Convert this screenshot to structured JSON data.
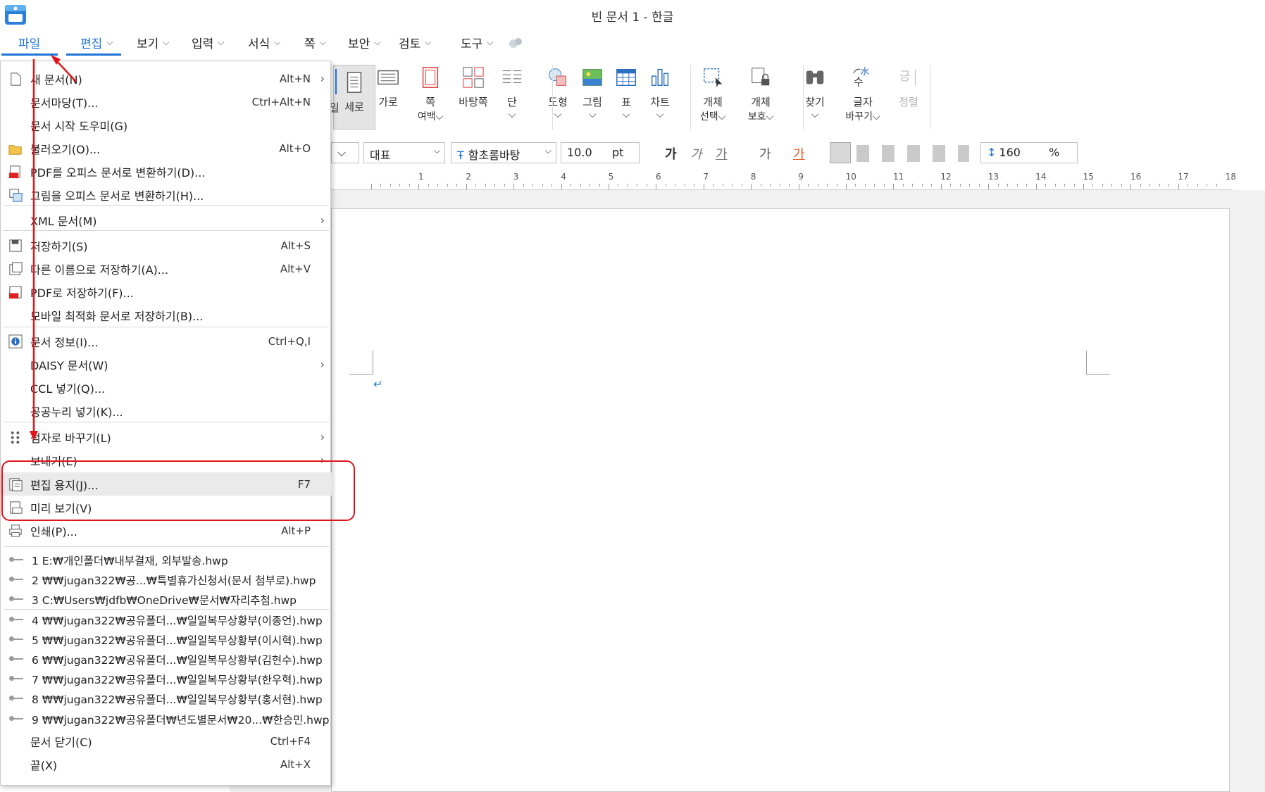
{
  "window": {
    "title": "빈 문서 1 - 한글"
  },
  "menubar": {
    "tabs": [
      {
        "label": "파일",
        "chev": false
      },
      {
        "label": "편집",
        "chev": true
      },
      {
        "label": "보기",
        "chev": true
      },
      {
        "label": "입력",
        "chev": true
      },
      {
        "label": "서식",
        "chev": true
      },
      {
        "label": "쪽",
        "chev": true
      },
      {
        "label": "보안",
        "chev": true
      },
      {
        "label": "검토",
        "chev": true
      },
      {
        "label": "도구",
        "chev": true
      }
    ]
  },
  "ribbon": {
    "buttons": [
      {
        "label": "세로",
        "sub": "",
        "icon": "portrait-icon",
        "active": true
      },
      {
        "label": "가로",
        "sub": "",
        "icon": "landscape-icon"
      },
      {
        "label": "쪽",
        "sub": "여백⌵",
        "icon": "page-margin-icon"
      },
      {
        "label": "바탕쪽",
        "sub": "",
        "icon": "master-page-icon"
      },
      {
        "label": "단",
        "sub": "⌵",
        "icon": "columns-icon"
      },
      {
        "label": "도형",
        "sub": "⌵",
        "icon": "shape-icon"
      },
      {
        "label": "그림",
        "sub": "⌵",
        "icon": "picture-icon"
      },
      {
        "label": "표",
        "sub": "⌵",
        "icon": "table-icon"
      },
      {
        "label": "차트",
        "sub": "⌵",
        "icon": "chart-icon"
      },
      {
        "label": "개체",
        "sub": "선택⌵",
        "icon": "object-select-icon"
      },
      {
        "label": "개체",
        "sub": "보호⌵",
        "icon": "object-protect-icon"
      },
      {
        "label": "찾기",
        "sub": "⌵",
        "icon": "find-icon"
      },
      {
        "label": "글자",
        "sub": "바꾸기⌵",
        "icon": "replace-icon"
      },
      {
        "label": "정렬",
        "sub": "",
        "icon": "sort-icon",
        "disabled": true
      }
    ],
    "partial_label": "일"
  },
  "format_bar": {
    "style": "대표",
    "font": "함초롬바탕",
    "font_prefix": "Ŧ",
    "size": "10.0",
    "size_unit": "pt",
    "line_spacing": "160",
    "line_spacing_unit": "%",
    "glyphs": [
      "가",
      "가",
      "가",
      "가",
      "가"
    ]
  },
  "ruler": {
    "numbers": [
      "1",
      "2",
      "3",
      "4",
      "5",
      "6",
      "7",
      "8",
      "9",
      "10",
      "11",
      "12",
      "13",
      "14",
      "15",
      "16",
      "17",
      "18"
    ]
  },
  "file_menu": {
    "items": [
      {
        "label": "새 문서(N)",
        "shortcut": "Alt+N",
        "arrow": true,
        "icon": "new-doc-icon"
      },
      {
        "label": "문서마당(T)...",
        "shortcut": "Ctrl+Alt+N",
        "icon": ""
      },
      {
        "label": "문서 시작 도우미(G)",
        "shortcut": "",
        "icon": ""
      },
      {
        "label": "불러오기(O)...",
        "shortcut": "Alt+O",
        "icon": "open-folder-icon"
      },
      {
        "label": "PDF를 오피스 문서로 변환하기(D)...",
        "shortcut": "",
        "icon": "pdf-icon"
      },
      {
        "label": "그림을 오피스 문서로 변환하기(H)...",
        "shortcut": "",
        "icon": "image-convert-icon"
      },
      {
        "label": "XML 문서(M)",
        "shortcut": "",
        "arrow": true,
        "icon": ""
      },
      {
        "label": "저장하기(S)",
        "shortcut": "Alt+S",
        "icon": "save-icon"
      },
      {
        "label": "다른 이름으로 저장하기(A)...",
        "shortcut": "Alt+V",
        "icon": "save-as-icon"
      },
      {
        "label": "PDF로 저장하기(F)...",
        "shortcut": "",
        "icon": "save-pdf-icon"
      },
      {
        "label": "모바일 최적화 문서로 저장하기(B)...",
        "shortcut": "",
        "icon": ""
      },
      {
        "label": "문서 정보(I)...",
        "shortcut": "Ctrl+Q,I",
        "icon": "info-icon"
      },
      {
        "label": "DAISY 문서(W)",
        "shortcut": "",
        "arrow": true,
        "icon": ""
      },
      {
        "label": "CCL 넣기(Q)...",
        "shortcut": "",
        "icon": ""
      },
      {
        "label": "공공누리 넣기(K)...",
        "shortcut": "",
        "icon": ""
      },
      {
        "label": "점자로 바꾸기(L)",
        "shortcut": "",
        "arrow": true,
        "icon": "braille-icon"
      },
      {
        "label": "보내기(E)",
        "shortcut": "",
        "arrow": true,
        "icon": ""
      },
      {
        "label": "편집 용지(J)...",
        "shortcut": "F7",
        "icon": "page-setup-icon"
      },
      {
        "label": "미리 보기(V)",
        "shortcut": "",
        "icon": "print-preview-icon"
      },
      {
        "label": "인쇄(P)...",
        "shortcut": "Alt+P",
        "icon": "print-icon"
      }
    ],
    "recent": [
      "1 E:₩개인폴더₩내부결재, 외부발송.hwp",
      "2 ₩₩jugan322₩공...₩특별휴가신청서(문서 첨부로).hwp",
      "3 C:₩Users₩jdfb₩OneDrive₩문서₩자리추첨.hwp",
      "4 ₩₩jugan322₩공유폴더...₩일일복무상황부(이종언).hwp",
      "5 ₩₩jugan322₩공유폴더...₩일일복무상황부(이시혁).hwp",
      "6 ₩₩jugan322₩공유폴더...₩일일복무상황부(김현수).hwp",
      "7 ₩₩jugan322₩공유폴더...₩일일복무상황부(한우혁).hwp",
      "8 ₩₩jugan322₩공유폴더...₩일일복무상황부(홍서현).hwp",
      "9 ₩₩jugan322₩공유폴더₩년도별문서₩20...₩한승민.hwp"
    ],
    "bottom": [
      {
        "label": "문서 닫기(C)",
        "shortcut": "Ctrl+F4"
      },
      {
        "label": "끝(X)",
        "shortcut": "Alt+X"
      }
    ]
  },
  "colors": {
    "accent": "#1e73d8",
    "annotation": "#e0151a",
    "highlight": "#eaeaea"
  }
}
